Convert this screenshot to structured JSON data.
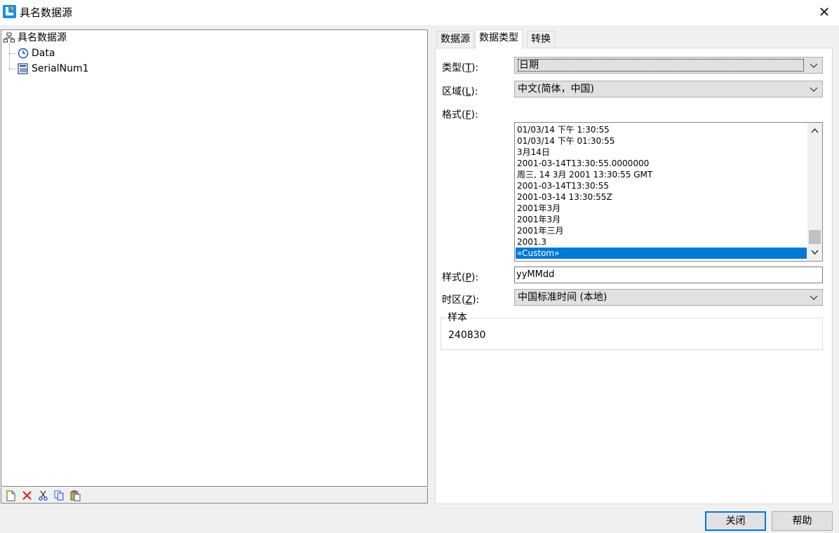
{
  "window": {
    "title": "具名数据源",
    "close_glyph": "✕",
    "brand_colors": {
      "blue": "#1f8fe0",
      "orange": "#f5a623"
    }
  },
  "tree": {
    "root": {
      "label": "具名数据源",
      "icon": "tree-root-icon"
    },
    "children": [
      {
        "label": "Data",
        "icon": "clock-icon"
      },
      {
        "label": "SerialNum1",
        "icon": "serial-number-icon"
      }
    ]
  },
  "tree_toolbar": {
    "buttons": [
      {
        "name": "new",
        "icon": "new-item-icon"
      },
      {
        "name": "delete",
        "icon": "delete-icon"
      },
      {
        "name": "cut",
        "icon": "cut-icon"
      },
      {
        "name": "copy",
        "icon": "copy-icon"
      },
      {
        "name": "paste",
        "icon": "paste-icon"
      }
    ]
  },
  "tabs": [
    {
      "label": "数据源",
      "active": false
    },
    {
      "label": "数据类型",
      "active": true
    },
    {
      "label": "转换",
      "active": false
    }
  ],
  "form": {
    "type": {
      "label": "类型(",
      "mnemonic": "T",
      "suffix": "):",
      "value": "日期"
    },
    "locale": {
      "label": "区域(",
      "mnemonic": "L",
      "suffix": "):",
      "value": "中文(简体，中国)"
    },
    "format": {
      "label": "格式(",
      "mnemonic": "F",
      "suffix": "):",
      "options": [
        "01/03/14 下午 1:30:55",
        "01/03/14 下午 01:30:55",
        "3月14日",
        "2001-03-14T13:30:55.0000000",
        "周三, 14 3月 2001 13:30:55 GMT",
        "2001-03-14T13:30:55",
        "2001-03-14 13:30:55Z",
        "2001年3月",
        "2001年3月",
        "2001年三月",
        "2001.3",
        "«Custom»"
      ],
      "selected_index": 11,
      "selection_color": "#0078d7"
    },
    "pattern": {
      "label": "样式(",
      "mnemonic": "P",
      "suffix": "):",
      "value": "yyMMdd"
    },
    "timezone": {
      "label": "时区(",
      "mnemonic": "Z",
      "suffix": "):",
      "value": "中国标准时间 (本地)"
    },
    "sample": {
      "legend": "样本",
      "value": "240830"
    }
  },
  "footer": {
    "close_label": "关闭",
    "help_label": "帮助",
    "default_button_color": "#0078d7"
  }
}
